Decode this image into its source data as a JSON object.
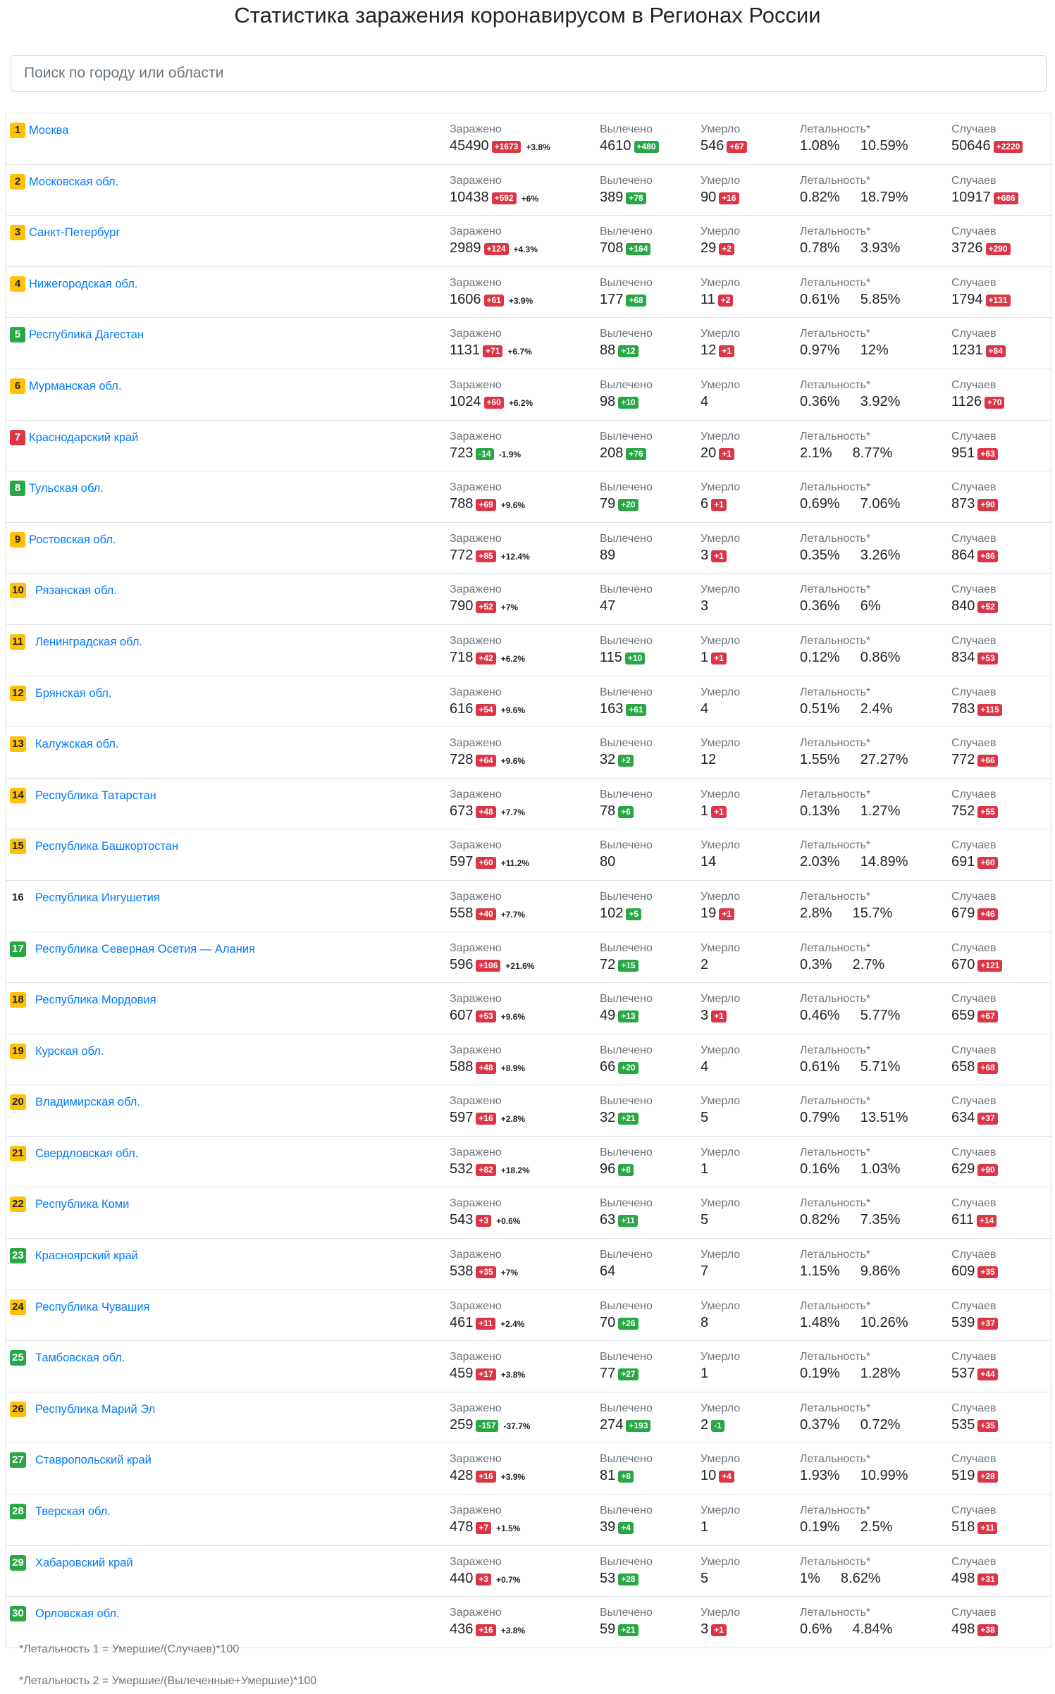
{
  "title": "Статистика заражения коронавирусом в Регионах России",
  "search": {
    "placeholder": "Поиск по городу или области"
  },
  "labels": {
    "infected": "Заражено",
    "recovered": "Вылечено",
    "deaths": "Умерло",
    "lethality": "Летальность*",
    "cases": "Случаев"
  },
  "footnotes": [
    "*Летальность 1 = Умершие/(Случаев)*100",
    "*Летальность 2 = Умершие/(Вылеченные+Умершие)*100"
  ],
  "colors": {
    "red": "#dc3545",
    "green": "#28a745",
    "yellow": "#ffc107",
    "link": "#007bff"
  },
  "regions": [
    {
      "rank": "1",
      "rank_color": "yellow",
      "name": "Москва",
      "infected": "45490",
      "infected_delta": "+1673",
      "infected_delta_color": "red",
      "infected_pct": "+3.8%",
      "recovered": "4610",
      "recovered_delta": "+480",
      "deaths": "546",
      "deaths_delta": "+67",
      "deaths_delta_color": "red",
      "lethality1": "1.08%",
      "lethality2": "10.59%",
      "cases": "50646",
      "cases_delta": "+2220"
    },
    {
      "rank": "2",
      "rank_color": "yellow",
      "name": "Московская обл.",
      "infected": "10438",
      "infected_delta": "+592",
      "infected_delta_color": "red",
      "infected_pct": "+6%",
      "recovered": "389",
      "recovered_delta": "+78",
      "deaths": "90",
      "deaths_delta": "+16",
      "deaths_delta_color": "red",
      "lethality1": "0.82%",
      "lethality2": "18.79%",
      "cases": "10917",
      "cases_delta": "+686"
    },
    {
      "rank": "3",
      "rank_color": "yellow",
      "name": "Санкт-Петербург",
      "infected": "2989",
      "infected_delta": "+124",
      "infected_delta_color": "red",
      "infected_pct": "+4.3%",
      "recovered": "708",
      "recovered_delta": "+164",
      "deaths": "29",
      "deaths_delta": "+2",
      "deaths_delta_color": "red",
      "lethality1": "0.78%",
      "lethality2": "3.93%",
      "cases": "3726",
      "cases_delta": "+290"
    },
    {
      "rank": "4",
      "rank_color": "yellow",
      "name": "Нижегородская обл.",
      "infected": "1606",
      "infected_delta": "+61",
      "infected_delta_color": "red",
      "infected_pct": "+3.9%",
      "recovered": "177",
      "recovered_delta": "+68",
      "deaths": "11",
      "deaths_delta": "+2",
      "deaths_delta_color": "red",
      "lethality1": "0.61%",
      "lethality2": "5.85%",
      "cases": "1794",
      "cases_delta": "+131"
    },
    {
      "rank": "5",
      "rank_color": "green",
      "name": "Республика Дагестан",
      "infected": "1131",
      "infected_delta": "+71",
      "infected_delta_color": "red",
      "infected_pct": "+6.7%",
      "recovered": "88",
      "recovered_delta": "+12",
      "deaths": "12",
      "deaths_delta": "+1",
      "deaths_delta_color": "red",
      "lethality1": "0.97%",
      "lethality2": "12%",
      "cases": "1231",
      "cases_delta": "+84"
    },
    {
      "rank": "6",
      "rank_color": "yellow",
      "name": "Мурманская обл.",
      "infected": "1024",
      "infected_delta": "+60",
      "infected_delta_color": "red",
      "infected_pct": "+6.2%",
      "recovered": "98",
      "recovered_delta": "+10",
      "deaths": "4",
      "deaths_delta": "",
      "deaths_delta_color": "red",
      "lethality1": "0.36%",
      "lethality2": "3.92%",
      "cases": "1126",
      "cases_delta": "+70"
    },
    {
      "rank": "7",
      "rank_color": "red",
      "name": "Краснодарский край",
      "infected": "723",
      "infected_delta": "-14",
      "infected_delta_color": "green",
      "infected_pct": "-1.9%",
      "recovered": "208",
      "recovered_delta": "+76",
      "deaths": "20",
      "deaths_delta": "+1",
      "deaths_delta_color": "red",
      "lethality1": "2.1%",
      "lethality2": "8.77%",
      "cases": "951",
      "cases_delta": "+63"
    },
    {
      "rank": "8",
      "rank_color": "green",
      "name": "Тульская обл.",
      "infected": "788",
      "infected_delta": "+69",
      "infected_delta_color": "red",
      "infected_pct": "+9.6%",
      "recovered": "79",
      "recovered_delta": "+20",
      "deaths": "6",
      "deaths_delta": "+1",
      "deaths_delta_color": "red",
      "lethality1": "0.69%",
      "lethality2": "7.06%",
      "cases": "873",
      "cases_delta": "+90"
    },
    {
      "rank": "9",
      "rank_color": "yellow",
      "name": "Ростовская обл.",
      "infected": "772",
      "infected_delta": "+85",
      "infected_delta_color": "red",
      "infected_pct": "+12.4%",
      "recovered": "89",
      "recovered_delta": "",
      "deaths": "3",
      "deaths_delta": "+1",
      "deaths_delta_color": "red",
      "lethality1": "0.35%",
      "lethality2": "3.26%",
      "cases": "864",
      "cases_delta": "+86"
    },
    {
      "rank": "10",
      "rank_color": "yellow",
      "name": "Рязанская обл.",
      "infected": "790",
      "infected_delta": "+52",
      "infected_delta_color": "red",
      "infected_pct": "+7%",
      "recovered": "47",
      "recovered_delta": "",
      "deaths": "3",
      "deaths_delta": "",
      "deaths_delta_color": "red",
      "lethality1": "0.36%",
      "lethality2": "6%",
      "cases": "840",
      "cases_delta": "+52"
    },
    {
      "rank": "11",
      "rank_color": "yellow",
      "name": "Ленинградская обл.",
      "infected": "718",
      "infected_delta": "+42",
      "infected_delta_color": "red",
      "infected_pct": "+6.2%",
      "recovered": "115",
      "recovered_delta": "+10",
      "deaths": "1",
      "deaths_delta": "+1",
      "deaths_delta_color": "red",
      "lethality1": "0.12%",
      "lethality2": "0.86%",
      "cases": "834",
      "cases_delta": "+53"
    },
    {
      "rank": "12",
      "rank_color": "yellow",
      "name": "Брянская обл.",
      "infected": "616",
      "infected_delta": "+54",
      "infected_delta_color": "red",
      "infected_pct": "+9.6%",
      "recovered": "163",
      "recovered_delta": "+61",
      "deaths": "4",
      "deaths_delta": "",
      "deaths_delta_color": "red",
      "lethality1": "0.51%",
      "lethality2": "2.4%",
      "cases": "783",
      "cases_delta": "+115"
    },
    {
      "rank": "13",
      "rank_color": "yellow",
      "name": "Калужская обл.",
      "infected": "728",
      "infected_delta": "+64",
      "infected_delta_color": "red",
      "infected_pct": "+9.6%",
      "recovered": "32",
      "recovered_delta": "+2",
      "deaths": "12",
      "deaths_delta": "",
      "deaths_delta_color": "red",
      "lethality1": "1.55%",
      "lethality2": "27.27%",
      "cases": "772",
      "cases_delta": "+66"
    },
    {
      "rank": "14",
      "rank_color": "yellow",
      "name": "Республика Татарстан",
      "infected": "673",
      "infected_delta": "+48",
      "infected_delta_color": "red",
      "infected_pct": "+7.7%",
      "recovered": "78",
      "recovered_delta": "+6",
      "deaths": "1",
      "deaths_delta": "+1",
      "deaths_delta_color": "red",
      "lethality1": "0.13%",
      "lethality2": "1.27%",
      "cases": "752",
      "cases_delta": "+55"
    },
    {
      "rank": "15",
      "rank_color": "yellow",
      "name": "Республика Башкортостан",
      "infected": "597",
      "infected_delta": "+60",
      "infected_delta_color": "red",
      "infected_pct": "+11.2%",
      "recovered": "80",
      "recovered_delta": "",
      "deaths": "14",
      "deaths_delta": "",
      "deaths_delta_color": "red",
      "lethality1": "2.03%",
      "lethality2": "14.89%",
      "cases": "691",
      "cases_delta": "+60"
    },
    {
      "rank": "16",
      "rank_color": "none",
      "name": "Республика Ингушетия",
      "infected": "558",
      "infected_delta": "+40",
      "infected_delta_color": "red",
      "infected_pct": "+7.7%",
      "recovered": "102",
      "recovered_delta": "+5",
      "deaths": "19",
      "deaths_delta": "+1",
      "deaths_delta_color": "red",
      "lethality1": "2.8%",
      "lethality2": "15.7%",
      "cases": "679",
      "cases_delta": "+46"
    },
    {
      "rank": "17",
      "rank_color": "green",
      "name": "Республика Северная Осетия — Алания",
      "infected": "596",
      "infected_delta": "+106",
      "infected_delta_color": "red",
      "infected_pct": "+21.6%",
      "recovered": "72",
      "recovered_delta": "+15",
      "deaths": "2",
      "deaths_delta": "",
      "deaths_delta_color": "red",
      "lethality1": "0.3%",
      "lethality2": "2.7%",
      "cases": "670",
      "cases_delta": "+121"
    },
    {
      "rank": "18",
      "rank_color": "yellow",
      "name": "Республика Мордовия",
      "infected": "607",
      "infected_delta": "+53",
      "infected_delta_color": "red",
      "infected_pct": "+9.6%",
      "recovered": "49",
      "recovered_delta": "+13",
      "deaths": "3",
      "deaths_delta": "+1",
      "deaths_delta_color": "red",
      "lethality1": "0.46%",
      "lethality2": "5.77%",
      "cases": "659",
      "cases_delta": "+67"
    },
    {
      "rank": "19",
      "rank_color": "yellow",
      "name": "Курская обл.",
      "infected": "588",
      "infected_delta": "+48",
      "infected_delta_color": "red",
      "infected_pct": "+8.9%",
      "recovered": "66",
      "recovered_delta": "+20",
      "deaths": "4",
      "deaths_delta": "",
      "deaths_delta_color": "red",
      "lethality1": "0.61%",
      "lethality2": "5.71%",
      "cases": "658",
      "cases_delta": "+68"
    },
    {
      "rank": "20",
      "rank_color": "yellow",
      "name": "Владимирская обл.",
      "infected": "597",
      "infected_delta": "+16",
      "infected_delta_color": "red",
      "infected_pct": "+2.8%",
      "recovered": "32",
      "recovered_delta": "+21",
      "deaths": "5",
      "deaths_delta": "",
      "deaths_delta_color": "red",
      "lethality1": "0.79%",
      "lethality2": "13.51%",
      "cases": "634",
      "cases_delta": "+37"
    },
    {
      "rank": "21",
      "rank_color": "yellow",
      "name": "Свердловская обл.",
      "infected": "532",
      "infected_delta": "+82",
      "infected_delta_color": "red",
      "infected_pct": "+18.2%",
      "recovered": "96",
      "recovered_delta": "+8",
      "deaths": "1",
      "deaths_delta": "",
      "deaths_delta_color": "red",
      "lethality1": "0.16%",
      "lethality2": "1.03%",
      "cases": "629",
      "cases_delta": "+90"
    },
    {
      "rank": "22",
      "rank_color": "yellow",
      "name": "Республика Коми",
      "infected": "543",
      "infected_delta": "+3",
      "infected_delta_color": "red",
      "infected_pct": "+0.6%",
      "recovered": "63",
      "recovered_delta": "+11",
      "deaths": "5",
      "deaths_delta": "",
      "deaths_delta_color": "red",
      "lethality1": "0.82%",
      "lethality2": "7.35%",
      "cases": "611",
      "cases_delta": "+14"
    },
    {
      "rank": "23",
      "rank_color": "green",
      "name": "Красноярский край",
      "infected": "538",
      "infected_delta": "+35",
      "infected_delta_color": "red",
      "infected_pct": "+7%",
      "recovered": "64",
      "recovered_delta": "",
      "deaths": "7",
      "deaths_delta": "",
      "deaths_delta_color": "red",
      "lethality1": "1.15%",
      "lethality2": "9.86%",
      "cases": "609",
      "cases_delta": "+35"
    },
    {
      "rank": "24",
      "rank_color": "yellow",
      "name": "Республика Чувашия",
      "infected": "461",
      "infected_delta": "+11",
      "infected_delta_color": "red",
      "infected_pct": "+2.4%",
      "recovered": "70",
      "recovered_delta": "+26",
      "deaths": "8",
      "deaths_delta": "",
      "deaths_delta_color": "red",
      "lethality1": "1.48%",
      "lethality2": "10.26%",
      "cases": "539",
      "cases_delta": "+37"
    },
    {
      "rank": "25",
      "rank_color": "green",
      "name": "Тамбовская обл.",
      "infected": "459",
      "infected_delta": "+17",
      "infected_delta_color": "red",
      "infected_pct": "+3.8%",
      "recovered": "77",
      "recovered_delta": "+27",
      "deaths": "1",
      "deaths_delta": "",
      "deaths_delta_color": "red",
      "lethality1": "0.19%",
      "lethality2": "1.28%",
      "cases": "537",
      "cases_delta": "+44"
    },
    {
      "rank": "26",
      "rank_color": "yellow",
      "name": "Республика Марий Эл",
      "infected": "259",
      "infected_delta": "-157",
      "infected_delta_color": "green",
      "infected_pct": "-37.7%",
      "recovered": "274",
      "recovered_delta": "+193",
      "deaths": "2",
      "deaths_delta": "-1",
      "deaths_delta_color": "green",
      "lethality1": "0.37%",
      "lethality2": "0.72%",
      "cases": "535",
      "cases_delta": "+35"
    },
    {
      "rank": "27",
      "rank_color": "green",
      "name": "Ставропольский край",
      "infected": "428",
      "infected_delta": "+16",
      "infected_delta_color": "red",
      "infected_pct": "+3.9%",
      "recovered": "81",
      "recovered_delta": "+8",
      "deaths": "10",
      "deaths_delta": "+4",
      "deaths_delta_color": "red",
      "lethality1": "1.93%",
      "lethality2": "10.99%",
      "cases": "519",
      "cases_delta": "+28"
    },
    {
      "rank": "28",
      "rank_color": "green",
      "name": "Тверская обл.",
      "infected": "478",
      "infected_delta": "+7",
      "infected_delta_color": "red",
      "infected_pct": "+1.5%",
      "recovered": "39",
      "recovered_delta": "+4",
      "deaths": "1",
      "deaths_delta": "",
      "deaths_delta_color": "red",
      "lethality1": "0.19%",
      "lethality2": "2.5%",
      "cases": "518",
      "cases_delta": "+11"
    },
    {
      "rank": "29",
      "rank_color": "green",
      "name": "Хабаровский край",
      "infected": "440",
      "infected_delta": "+3",
      "infected_delta_color": "red",
      "infected_pct": "+0.7%",
      "recovered": "53",
      "recovered_delta": "+28",
      "deaths": "5",
      "deaths_delta": "",
      "deaths_delta_color": "red",
      "lethality1": "1%",
      "lethality2": "8.62%",
      "cases": "498",
      "cases_delta": "+31"
    },
    {
      "rank": "30",
      "rank_color": "green",
      "name": "Орловская обл.",
      "infected": "436",
      "infected_delta": "+16",
      "infected_delta_color": "red",
      "infected_pct": "+3.8%",
      "recovered": "59",
      "recovered_delta": "+21",
      "deaths": "3",
      "deaths_delta": "+1",
      "deaths_delta_color": "red",
      "lethality1": "0.6%",
      "lethality2": "4.84%",
      "cases": "498",
      "cases_delta": "+38"
    }
  ]
}
